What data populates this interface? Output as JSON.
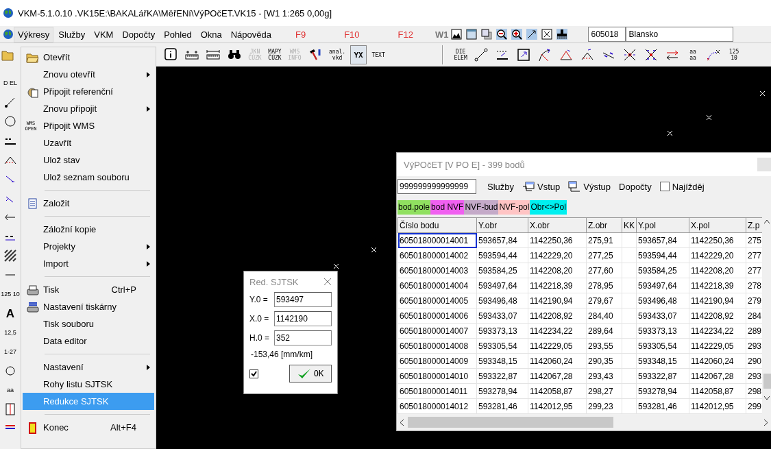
{
  "window": {
    "title": "VKM-5.1.0.10 .VK15E:\\BAKALářKA\\MěřENí\\VýPOčET.VK15 - [W1 1:265 0,00g]"
  },
  "menubar": [
    {
      "label": "Výkresy",
      "kind": "menu",
      "selected": true
    },
    {
      "label": "Služby",
      "kind": "menu",
      "selected": false
    },
    {
      "label": "VKM",
      "kind": "menu",
      "selected": false
    },
    {
      "label": "Dopočty",
      "kind": "menu",
      "selected": false
    },
    {
      "label": "Pohled",
      "kind": "menu",
      "selected": false
    },
    {
      "label": "Okna",
      "kind": "menu",
      "selected": false
    },
    {
      "label": "Nápověda",
      "kind": "menu",
      "selected": false
    },
    {
      "label": "F9",
      "kind": "fkey",
      "selected": false
    },
    {
      "label": "F10",
      "kind": "fkey",
      "selected": false
    },
    {
      "label": "F12",
      "kind": "fkey",
      "selected": false
    }
  ],
  "window_tools": {
    "label": "W1",
    "code": "605018",
    "place": "Blansko"
  },
  "toolbar": [
    {
      "kind": "icon"
    },
    {
      "kind": "icon"
    },
    {
      "kind": "icon"
    },
    {
      "kind": "icon"
    },
    {
      "kind": "text",
      "lines": [
        "JKN",
        "ČÚZK"
      ],
      "disabled": true,
      "selected": false
    },
    {
      "kind": "text",
      "lines": [
        "MAPY",
        "ČÚZK"
      ],
      "disabled": false,
      "selected": false
    },
    {
      "kind": "text",
      "lines": [
        "WMS",
        "INFO"
      ],
      "disabled": true,
      "selected": false
    },
    {
      "kind": "icon"
    },
    {
      "kind": "text",
      "lines": [
        "anal.",
        "vkd"
      ],
      "disabled": false,
      "selected": false
    },
    {
      "kind": "text",
      "lines": [
        "YX"
      ],
      "disabled": false,
      "selected": true
    },
    {
      "kind": "text",
      "lines": [
        "TEXT"
      ],
      "disabled": false,
      "selected": false
    },
    {
      "kind": "separator"
    },
    {
      "kind": "text",
      "lines": [
        "DIE",
        "ELEM"
      ],
      "disabled": false,
      "selected": false
    },
    {
      "kind": "icon"
    },
    {
      "kind": "icon"
    },
    {
      "kind": "icon"
    },
    {
      "kind": "icon"
    },
    {
      "kind": "icon"
    },
    {
      "kind": "icon"
    },
    {
      "kind": "icon"
    },
    {
      "kind": "icon"
    },
    {
      "kind": "icon"
    },
    {
      "kind": "icon"
    },
    {
      "kind": "text",
      "lines": [
        "aa",
        "aa"
      ],
      "disabled": false,
      "selected": false
    },
    {
      "kind": "icon"
    },
    {
      "kind": "text",
      "lines": [
        "125",
        "10"
      ],
      "disabled": false,
      "selected": false
    }
  ],
  "left_toolbar": [
    {
      "kind": "text",
      "label": "D EL"
    },
    {
      "kind": "icon"
    },
    {
      "kind": "icon"
    },
    {
      "kind": "icon"
    },
    {
      "kind": "icon"
    },
    {
      "kind": "icon"
    },
    {
      "kind": "icon"
    },
    {
      "kind": "icon"
    },
    {
      "kind": "icon"
    },
    {
      "kind": "icon"
    },
    {
      "kind": "icon"
    },
    {
      "kind": "text",
      "label": "125 10"
    },
    {
      "kind": "text",
      "label": "A"
    },
    {
      "kind": "text",
      "label": "12,5"
    },
    {
      "kind": "text",
      "label": "1-27"
    },
    {
      "kind": "icon"
    },
    {
      "kind": "text",
      "label": "aa"
    },
    {
      "kind": "icon"
    },
    {
      "kind": "icon"
    }
  ],
  "menu": [
    {
      "kind": "item",
      "label": "Otevřít",
      "has_icon": true,
      "submenu": false,
      "selected": false
    },
    {
      "kind": "item",
      "label": "Znovu otevřít",
      "has_icon": false,
      "submenu": true,
      "selected": false
    },
    {
      "kind": "item",
      "label": "Připojit referenční",
      "has_icon": true,
      "submenu": false,
      "selected": false
    },
    {
      "kind": "item",
      "label": "Znovu připojit",
      "has_icon": false,
      "submenu": true,
      "selected": false
    },
    {
      "kind": "item",
      "label": "Připojit WMS",
      "icon_text": "WMS OPEN",
      "submenu": false,
      "selected": false
    },
    {
      "kind": "item",
      "label": "Uzavřít",
      "has_icon": false,
      "submenu": false,
      "selected": false
    },
    {
      "kind": "item",
      "label": "Ulož stav",
      "has_icon": false,
      "submenu": false,
      "selected": false
    },
    {
      "kind": "item",
      "label": "Ulož seznam souboru",
      "has_icon": false,
      "submenu": false,
      "selected": false
    },
    {
      "kind": "separator"
    },
    {
      "kind": "item",
      "label": "Založit",
      "has_icon": true,
      "submenu": false,
      "selected": false
    },
    {
      "kind": "separator"
    },
    {
      "kind": "item",
      "label": "Záložní kopie",
      "has_icon": false,
      "submenu": false,
      "selected": false
    },
    {
      "kind": "item",
      "label": "Projekty",
      "has_icon": false,
      "submenu": true,
      "selected": false
    },
    {
      "kind": "item",
      "label": "Import",
      "has_icon": false,
      "submenu": true,
      "selected": false
    },
    {
      "kind": "separator"
    },
    {
      "kind": "item",
      "label": "Tisk",
      "shortcut": "Ctrl+P",
      "has_icon": true,
      "submenu": false,
      "selected": false
    },
    {
      "kind": "item",
      "label": "Nastavení tiskárny",
      "has_icon": true,
      "submenu": false,
      "selected": false
    },
    {
      "kind": "item",
      "label": "Tisk souboru",
      "has_icon": false,
      "submenu": false,
      "selected": false
    },
    {
      "kind": "item",
      "label": "Data editor",
      "has_icon": false,
      "submenu": false,
      "selected": false
    },
    {
      "kind": "separator"
    },
    {
      "kind": "item",
      "label": "Nastavení",
      "has_icon": false,
      "submenu": true,
      "selected": false
    },
    {
      "kind": "item",
      "label": "Rohy listu SJTSK",
      "has_icon": false,
      "submenu": false,
      "selected": false
    },
    {
      "kind": "item",
      "label": "Redukce SJTSK",
      "has_icon": false,
      "submenu": false,
      "selected": true
    },
    {
      "kind": "separator"
    },
    {
      "kind": "item",
      "label": "Konec",
      "shortcut": "Alt+F4",
      "has_icon": true,
      "submenu": false,
      "selected": false
    }
  ],
  "dialog": {
    "title": "Red. SJTSK",
    "fields": [
      {
        "label": "Y.0 =",
        "value": "593497"
      },
      {
        "label": "X.0 =",
        "value": "1142190"
      },
      {
        "label": "H.0 =",
        "value": "352"
      }
    ],
    "result": "-153,46 [mm/km]",
    "checked": true,
    "ok": "OK"
  },
  "table_window": {
    "title": "VýPOčET [V PO E] - 399 bodů",
    "search": "999999999999999",
    "tools": [
      {
        "kind": "menu",
        "label": "Služby"
      },
      {
        "kind": "icon",
        "label": "Vstup"
      },
      {
        "kind": "icon",
        "label": "Výstup"
      },
      {
        "kind": "menu",
        "label": "Dopočty"
      },
      {
        "kind": "checkbox",
        "label": "Najížděj",
        "checked": false
      }
    ],
    "legend": [
      {
        "label": "bod.pole",
        "color": "#90e060"
      },
      {
        "label": "bod NVF",
        "color": "#f060f0"
      },
      {
        "label": "NVF-bud",
        "color": "#c4aac8"
      },
      {
        "label": "NVF-pol",
        "color": "#ffc4c4"
      },
      {
        "label": "Obr<>Pol",
        "color": "#00f0f0"
      }
    ],
    "columns": [
      "Číslo bodu",
      "Y.obr",
      "X.obr",
      "Z.obr",
      "KK",
      "Y.pol",
      "X.pol",
      "Z.p"
    ],
    "rows": [
      {
        "selected": true,
        "cells": [
          "605018000014001",
          "593657,84",
          "1142250,36",
          "275,91",
          "",
          "593657,84",
          "1142250,36",
          "275"
        ]
      },
      {
        "selected": false,
        "cells": [
          "605018000014002",
          "593594,44",
          "1142229,20",
          "277,25",
          "",
          "593594,44",
          "1142229,20",
          "277"
        ]
      },
      {
        "selected": false,
        "cells": [
          "605018000014003",
          "593584,25",
          "1142208,20",
          "277,60",
          "",
          "593584,25",
          "1142208,20",
          "277"
        ]
      },
      {
        "selected": false,
        "cells": [
          "605018000014004",
          "593497,64",
          "1142218,39",
          "278,95",
          "",
          "593497,64",
          "1142218,39",
          "278"
        ]
      },
      {
        "selected": false,
        "cells": [
          "605018000014005",
          "593496,48",
          "1142190,94",
          "279,67",
          "",
          "593496,48",
          "1142190,94",
          "279"
        ]
      },
      {
        "selected": false,
        "cells": [
          "605018000014006",
          "593433,07",
          "1142208,92",
          "284,40",
          "",
          "593433,07",
          "1142208,92",
          "284"
        ]
      },
      {
        "selected": false,
        "cells": [
          "605018000014007",
          "593373,13",
          "1142234,22",
          "289,64",
          "",
          "593373,13",
          "1142234,22",
          "289"
        ]
      },
      {
        "selected": false,
        "cells": [
          "605018000014008",
          "593305,54",
          "1142229,05",
          "293,55",
          "",
          "593305,54",
          "1142229,05",
          "293"
        ]
      },
      {
        "selected": false,
        "cells": [
          "605018000014009",
          "593348,15",
          "1142060,24",
          "290,35",
          "",
          "593348,15",
          "1142060,24",
          "290"
        ]
      },
      {
        "selected": false,
        "cells": [
          "605018000014010",
          "593322,87",
          "1142067,28",
          "293,43",
          "",
          "593322,87",
          "1142067,28",
          "293"
        ]
      },
      {
        "selected": false,
        "cells": [
          "605018000014011",
          "593278,94",
          "1142058,87",
          "298,27",
          "",
          "593278,94",
          "1142058,87",
          "298"
        ]
      },
      {
        "selected": false,
        "cells": [
          "605018000014012",
          "593281,46",
          "1142012,95",
          "299,23",
          "",
          "593281,46",
          "1142012,95",
          "299"
        ]
      }
    ]
  }
}
